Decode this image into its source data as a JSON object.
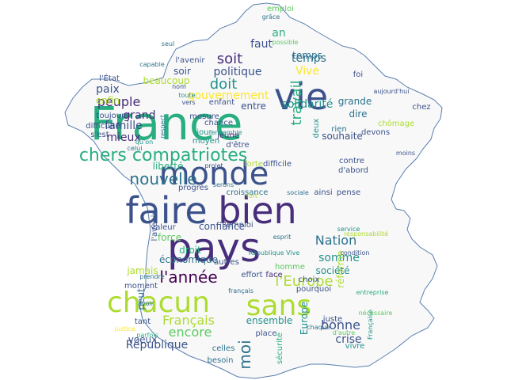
{
  "colors": {
    "background": "#ffffff",
    "map_fill": "#f8f8f8",
    "map_outline": "#5a7fb0",
    "palette": [
      "#440154",
      "#472d7b",
      "#3b528b",
      "#2c728e",
      "#21918c",
      "#28ae80",
      "#5ec962",
      "#addc30",
      "#fde725"
    ]
  },
  "words": [
    {
      "text": "France",
      "c": 5
    },
    {
      "text": "pays",
      "c": 1
    },
    {
      "text": "faire",
      "c": 2
    },
    {
      "text": "bien",
      "c": 1
    },
    {
      "text": "monde",
      "c": 2
    },
    {
      "text": "vie",
      "c": 2
    },
    {
      "text": "chacun",
      "c": 7
    },
    {
      "text": "sans",
      "c": 7
    },
    {
      "text": "chers compatriotes",
      "c": 5
    },
    {
      "text": "nouvelle",
      "c": 3
    },
    {
      "text": "l'année",
      "c": 0
    },
    {
      "text": "l'Europe",
      "c": 7
    },
    {
      "text": "Français",
      "c": 7
    },
    {
      "text": "peuple",
      "c": 1
    },
    {
      "text": "doit",
      "c": 4
    },
    {
      "text": "Nation",
      "c": 3
    },
    {
      "text": "somme",
      "c": 4
    },
    {
      "text": "bonne",
      "c": 2
    },
    {
      "text": "encore",
      "c": 6
    },
    {
      "text": "moi",
      "c": 3
    },
    {
      "text": "travail",
      "c": 5
    },
    {
      "text": "soit",
      "c": 1
    },
    {
      "text": "Vive",
      "c": 8
    },
    {
      "text": "politique",
      "c": 2
    },
    {
      "text": "temps",
      "c": 3
    },
    {
      "text": "gouvernement",
      "c": 8
    },
    {
      "text": "solidarité",
      "c": 4
    },
    {
      "text": "grande",
      "c": 3
    },
    {
      "text": "dire",
      "c": 3
    },
    {
      "text": "entre",
      "c": 2
    },
    {
      "text": "beaucoup",
      "c": 7
    },
    {
      "text": "soir",
      "c": 2
    },
    {
      "text": "paix",
      "c": 2
    },
    {
      "text": "grand",
      "c": 1
    },
    {
      "text": "famille",
      "c": 2
    },
    {
      "text": "mieux",
      "c": 1
    },
    {
      "text": "enfin",
      "c": 7
    },
    {
      "text": "liberté",
      "c": 5
    },
    {
      "text": "souhaite",
      "c": 2
    },
    {
      "text": "force",
      "c": 6
    },
    {
      "text": "confiance",
      "c": 2
    },
    {
      "text": "droit",
      "c": 5
    },
    {
      "text": "économique",
      "c": 3
    },
    {
      "text": "réforme",
      "c": 7
    },
    {
      "text": "société",
      "c": 4
    },
    {
      "text": "crise",
      "c": 2
    },
    {
      "text": "voeux",
      "c": 2
    },
    {
      "text": "République",
      "c": 2
    },
    {
      "text": "ensemble",
      "c": 4
    },
    {
      "text": "temps",
      "c": 3
    },
    {
      "text": "faut",
      "c": 2
    },
    {
      "text": "an",
      "c": 5
    },
    {
      "text": "jamais",
      "c": 7
    },
    {
      "text": "peut",
      "c": 3
    },
    {
      "text": "moment",
      "c": 2
    },
    {
      "text": "tant",
      "c": 2
    },
    {
      "text": "Europe",
      "c": 4
    },
    {
      "text": "autres",
      "c": 2
    },
    {
      "text": "effort",
      "c": 2
    },
    {
      "text": "choix",
      "c": 2
    },
    {
      "text": "face",
      "c": 1
    },
    {
      "text": "homme",
      "c": 6
    },
    {
      "text": "pourquoi",
      "c": 2
    },
    {
      "text": "juste",
      "c": 2
    },
    {
      "text": "vivre",
      "c": 4
    },
    {
      "text": "besoin",
      "c": 3
    },
    {
      "text": "place",
      "c": 2
    },
    {
      "text": "celles",
      "c": 3
    },
    {
      "text": "sécurité",
      "c": 5
    },
    {
      "text": "croissance",
      "c": 3
    },
    {
      "text": "ainsi",
      "c": 2
    },
    {
      "text": "pense",
      "c": 2
    },
    {
      "text": "l'emploi",
      "c": 2
    },
    {
      "text": "valeur",
      "c": 2
    },
    {
      "text": "l'avenir",
      "c": 2
    },
    {
      "text": "progrès",
      "c": 2
    },
    {
      "text": "difficile",
      "c": 2
    },
    {
      "text": "forte",
      "c": 7
    },
    {
      "text": "chance",
      "c": 2
    },
    {
      "text": "jour",
      "c": 4
    },
    {
      "text": "moyen",
      "c": 4
    },
    {
      "text": "jeune",
      "c": 1
    },
    {
      "text": "d'être",
      "c": 2
    },
    {
      "text": "devons",
      "c": 2
    },
    {
      "text": "moins",
      "c": 2
    },
    {
      "text": "chômage",
      "c": 7
    },
    {
      "text": "rien",
      "c": 3
    },
    {
      "text": "deux",
      "c": 4
    },
    {
      "text": "foi",
      "c": 2
    },
    {
      "text": "aujourd'hui",
      "c": 2
    },
    {
      "text": "chez",
      "c": 2
    },
    {
      "text": "contre",
      "c": 2
    },
    {
      "text": "d'abord",
      "c": 2
    },
    {
      "text": "toujours",
      "c": 2
    },
    {
      "text": "difficulté",
      "c": 2
    },
    {
      "text": "s'est",
      "c": 2
    },
    {
      "text": "l'État",
      "c": 2
    },
    {
      "text": "l'avenir",
      "c": 2
    },
    {
      "text": "toute",
      "c": 4
    },
    {
      "text": "nom",
      "c": 2
    },
    {
      "text": "enfant",
      "c": 2
    },
    {
      "text": "mesure",
      "c": 2
    },
    {
      "text": "vers",
      "c": 2
    },
    {
      "text": "possible",
      "c": 6
    },
    {
      "text": "emploi",
      "c": 6
    },
    {
      "text": "grâce",
      "c": 3
    },
    {
      "text": "sociale",
      "c": 3
    },
    {
      "text": "fort",
      "c": 7
    },
    {
      "text": "service",
      "c": 4
    },
    {
      "text": "responsabilité",
      "c": 7
    },
    {
      "text": "justice",
      "c": 8
    },
    {
      "text": "Française",
      "c": 4
    },
    {
      "text": "entreprise",
      "c": 5
    },
    {
      "text": "nécessaire",
      "c": 6
    },
    {
      "text": "d'autre",
      "c": 6
    },
    {
      "text": "serons",
      "c": 3
    },
    {
      "text": "projet",
      "c": 2
    },
    {
      "text": "chaque",
      "c": 3
    },
    {
      "text": "français",
      "c": 3
    },
    {
      "text": "condition",
      "c": 2
    },
    {
      "text": "ensemble",
      "c": 4
    },
    {
      "text": "parfois",
      "c": 5
    },
    {
      "text": "prendre",
      "c": 3
    },
    {
      "text": "avoir",
      "c": 3
    },
    {
      "text": "République Vive",
      "c": 4
    },
    {
      "text": "qu'on",
      "c": 4
    },
    {
      "text": "celui",
      "c": 3
    },
    {
      "text": "respect",
      "c": 3
    },
    {
      "text": "esprit",
      "c": 3
    },
    {
      "text": "capable",
      "c": 3
    },
    {
      "text": "seul",
      "c": 3
    },
    {
      "text": "ans",
      "c": 3
    },
    {
      "text": "nos",
      "c": 3
    }
  ]
}
